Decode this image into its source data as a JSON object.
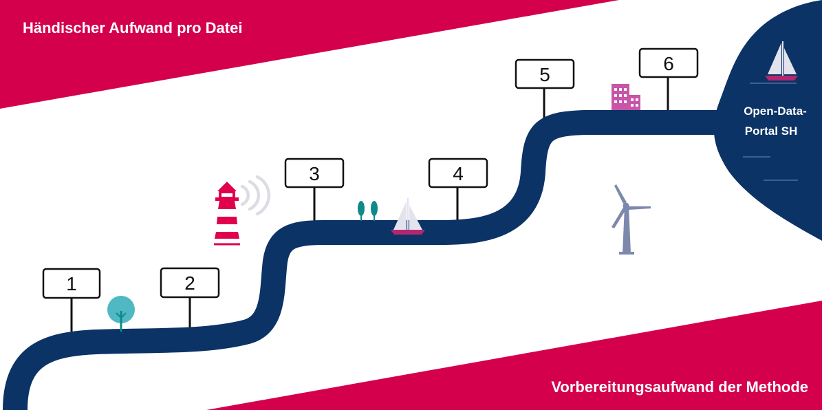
{
  "banners": {
    "top": "Händischer Aufwand pro Datei",
    "bottom": "Vorbereitungsaufwand der Methode"
  },
  "signs": [
    "1",
    "2",
    "3",
    "4",
    "5",
    "6"
  ],
  "portal": {
    "line1": "Open-Data-",
    "line2": "Portal SH"
  },
  "colors": {
    "banner": "#d4004c",
    "river": "#0b3366",
    "turbine": "#7d88ad",
    "lighthouse": "#e0004d",
    "tree_teal": "#4fb8c2",
    "tree_dark": "#0e8a8a",
    "building": "#c855a8",
    "sail": "#e3e3ee",
    "hull": "#b52670"
  }
}
